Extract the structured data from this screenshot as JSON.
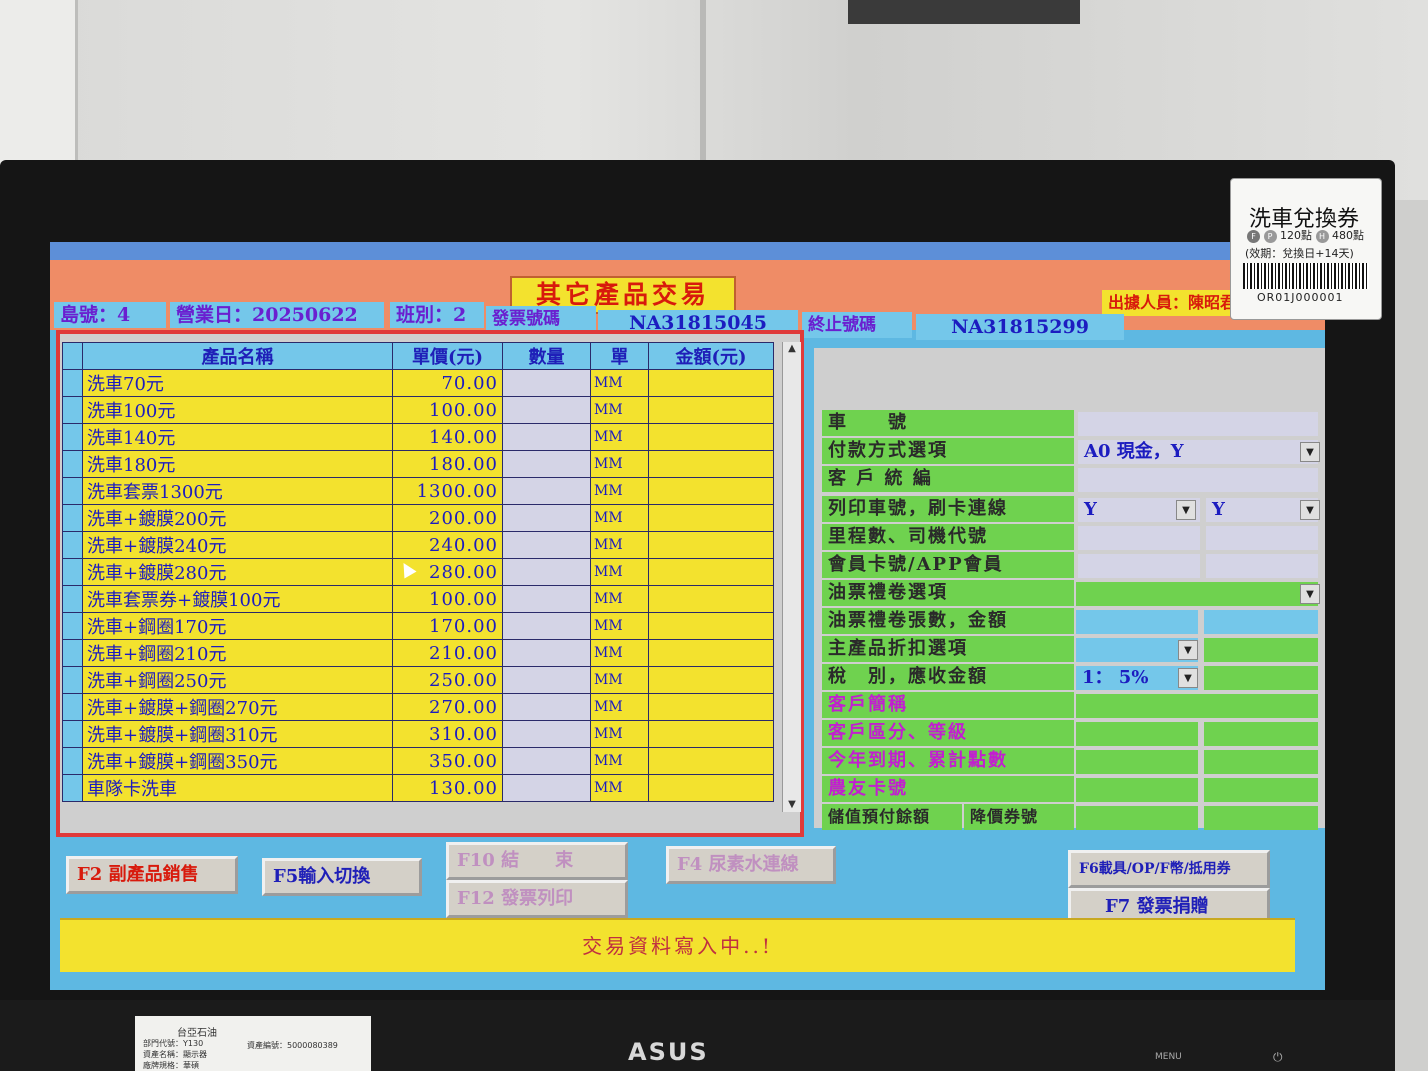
{
  "window": {
    "title": "其它產品交易"
  },
  "header": {
    "station_label": "島號：4",
    "business_date_label": "營業日：20250622",
    "shift_label": "班別：2",
    "invoice_no_label": "發票號碼",
    "invoice_no_value": "NA31815045",
    "end_no_label": "終止號碼",
    "end_no_value": "NA31815299",
    "operator": "出據人員：陳昭君"
  },
  "product_table": {
    "columns": [
      "產品名稱",
      "單價(元)",
      "數量",
      "單",
      "金額(元)"
    ],
    "rows": [
      {
        "name": "洗車70元",
        "price": "70.00",
        "unit": "MM"
      },
      {
        "name": "洗車100元",
        "price": "100.00",
        "unit": "MM"
      },
      {
        "name": "洗車140元",
        "price": "140.00",
        "unit": "MM"
      },
      {
        "name": "洗車180元",
        "price": "180.00",
        "unit": "MM"
      },
      {
        "name": "洗車套票1300元",
        "price": "1300.00",
        "unit": "MM"
      },
      {
        "name": "洗車+鍍膜200元",
        "price": "200.00",
        "unit": "MM"
      },
      {
        "name": "洗車+鍍膜240元",
        "price": "240.00",
        "unit": "MM"
      },
      {
        "name": "洗車+鍍膜280元",
        "price": "280.00",
        "unit": "MM"
      },
      {
        "name": "洗車套票券+鍍膜100元",
        "price": "100.00",
        "unit": "MM"
      },
      {
        "name": "洗車+鋼圈170元",
        "price": "170.00",
        "unit": "MM"
      },
      {
        "name": "洗車+鋼圈210元",
        "price": "210.00",
        "unit": "MM"
      },
      {
        "name": "洗車+鋼圈250元",
        "price": "250.00",
        "unit": "MM"
      },
      {
        "name": "洗車+鍍膜+鋼圈270元",
        "price": "270.00",
        "unit": "MM"
      },
      {
        "name": "洗車+鍍膜+鋼圈310元",
        "price": "310.00",
        "unit": "MM"
      },
      {
        "name": "洗車+鍍膜+鋼圈350元",
        "price": "350.00",
        "unit": "MM"
      },
      {
        "name": "車隊卡洗車",
        "price": "130.00",
        "unit": "MM"
      }
    ]
  },
  "form": {
    "car_no_label": "車　　號",
    "payment_label": "付款方式選項",
    "payment_value": "A0  現金，Y",
    "customer_id_label": "客 戶 統 編",
    "print_label": "列印車號，刷卡連線",
    "print_value_1": "Y",
    "print_value_2": "Y",
    "mileage_label": "里程數、司機代號",
    "member_label": "會員卡號/APP會員",
    "fuel_coupon_label": "油票禮卷選項",
    "fuel_coupon_count_label": "油票禮卷張數，金額",
    "discount_label": "主產品折扣選項",
    "tax_label": "稅　別，應收金額",
    "tax_value": "1：  5%",
    "customer_short_label": "客戶簡稱",
    "customer_class_label": "客戶區分、等級",
    "year_points_label": "今年到期、累計點數",
    "farmer_card_label": "農友卡號",
    "stored_value_label": "儲值預付餘額",
    "price_coupon_label": "降價券號"
  },
  "buttons": {
    "f2": "F2 副產品銷售",
    "f5": "F5輸入切換",
    "f10": "F10 結　　束",
    "f12": "F12 發票列印",
    "f4": "F4 尿素水連線",
    "f6": "F6載具/OP/F幣/抵用券",
    "f7": "F7 發票捐贈"
  },
  "status": {
    "message": "交易資料寫入中..!"
  },
  "sticker": {
    "title": "洗車兌換券",
    "points_a": "120點",
    "points_b": "480點",
    "validity": "(效期：兌換日+14天)",
    "code": "OR01J000001"
  },
  "monitor": {
    "brand": "ASUS",
    "menu_label": "MENU"
  },
  "asset_label": {
    "company": "台亞石油",
    "asset_no": "資產編號：5000080389",
    "dept": "部門代號：Y130",
    "asset_name": "資產名稱：顯示器",
    "model": "廠牌規格：華碩"
  }
}
